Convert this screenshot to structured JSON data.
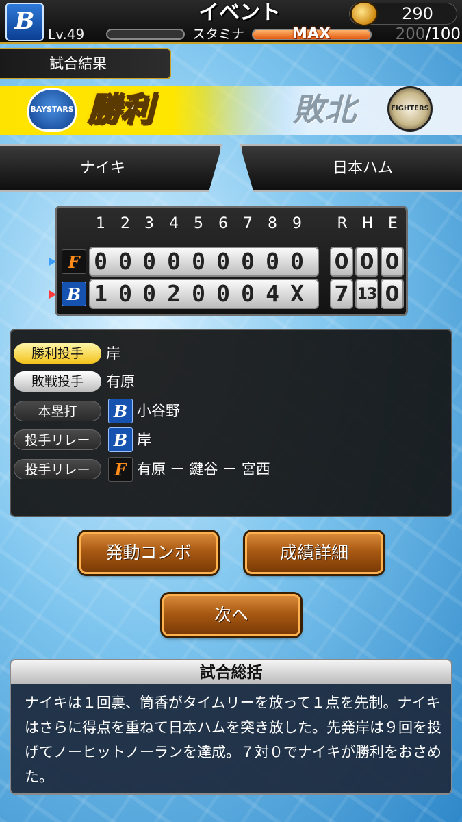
{
  "header": {
    "title": "イベント",
    "coin_value": "290",
    "level": "Lv.49",
    "stamina_label": "スタミナ",
    "stamina_status": "MAX",
    "stamina_current": "200",
    "stamina_sep": "/",
    "stamina_max": "100",
    "team_logo_glyph": "B"
  },
  "result": {
    "section_label": "試合結果",
    "win_text": "勝利",
    "lose_text": "敗北",
    "home_logo_text": "BAYSTARS",
    "away_logo_text": "FIGHTERS",
    "home_team_name": "ナイキ",
    "away_team_name": "日本ハム"
  },
  "scoreboard": {
    "innings": [
      "1",
      "2",
      "3",
      "4",
      "5",
      "6",
      "7",
      "8",
      "9"
    ],
    "rhe_headers": [
      "R",
      "H",
      "E"
    ],
    "away": {
      "icon_glyph": "F",
      "line": [
        "0",
        "0",
        "0",
        "0",
        "0",
        "0",
        "0",
        "0",
        "0"
      ],
      "rhe": [
        "0",
        "0",
        "0"
      ]
    },
    "home": {
      "icon_glyph": "B",
      "line": [
        "1",
        "0",
        "0",
        "2",
        "0",
        "0",
        "0",
        "4",
        "X"
      ],
      "rhe": [
        "7",
        "13",
        "0"
      ]
    }
  },
  "pitching": {
    "win_label": "勝利投手",
    "win_pitcher": "岸",
    "loss_label": "敗戦投手",
    "loss_pitcher": "有原",
    "hr_label": "本塁打",
    "hr_player": "小谷野",
    "relay_label_home": "投手リレー",
    "relay_home": "岸",
    "relay_label_away": "投手リレー",
    "relay_away": "有原 ー 鍵谷 ー 宮西",
    "home_icon_glyph": "B",
    "away_icon_glyph": "F"
  },
  "buttons": {
    "combo": "発動コンボ",
    "details": "成績詳細",
    "next": "次へ"
  },
  "summary": {
    "title": "試合総括",
    "text": "ナイキは１回裏、筒香がタイムリーを放って１点を先制。ナイキはさらに得点を重ねて日本ハムを突き放した。先発岸は９回を投げてノーヒットノーランを達成。７対０でナイキが勝利をおさめた。"
  },
  "colors": {
    "accent_gold": "#c9a227",
    "win_yellow": "#ffe300",
    "button_orange": "#a95a13",
    "home_blue": "#1653b0",
    "away_orange": "#ff8c1a"
  }
}
